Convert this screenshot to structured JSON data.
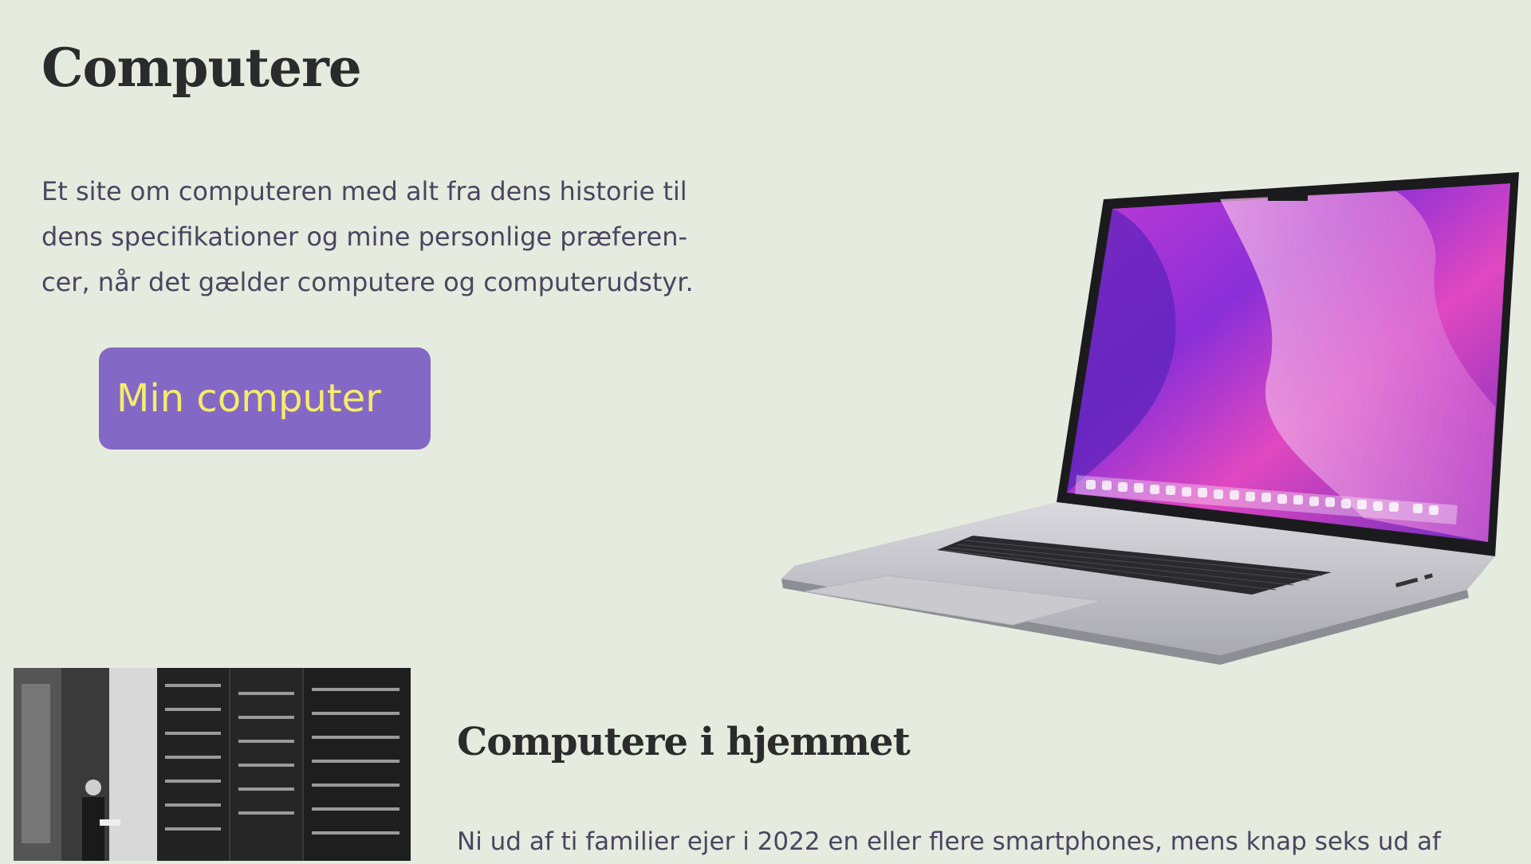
{
  "header": {
    "title": "Computere"
  },
  "intro": {
    "text": "Et site om computeren med alt fra dens historie til dens specifikationer og mine personlige præferen-cer, når det gælder computere og computerudstyr."
  },
  "cta": {
    "label": "Min computer"
  },
  "section_home": {
    "heading": "Computere i hjemmet",
    "body": "Ni ud af ti familier ejer i 2022 en eller flere smartphones, mens knap seks ud af"
  },
  "colors": {
    "background": "#e6ebdf",
    "button": "#8468c6",
    "button_text": "#f5ec6a",
    "heading": "#2b2b2b",
    "body_text": "#4a4560"
  }
}
